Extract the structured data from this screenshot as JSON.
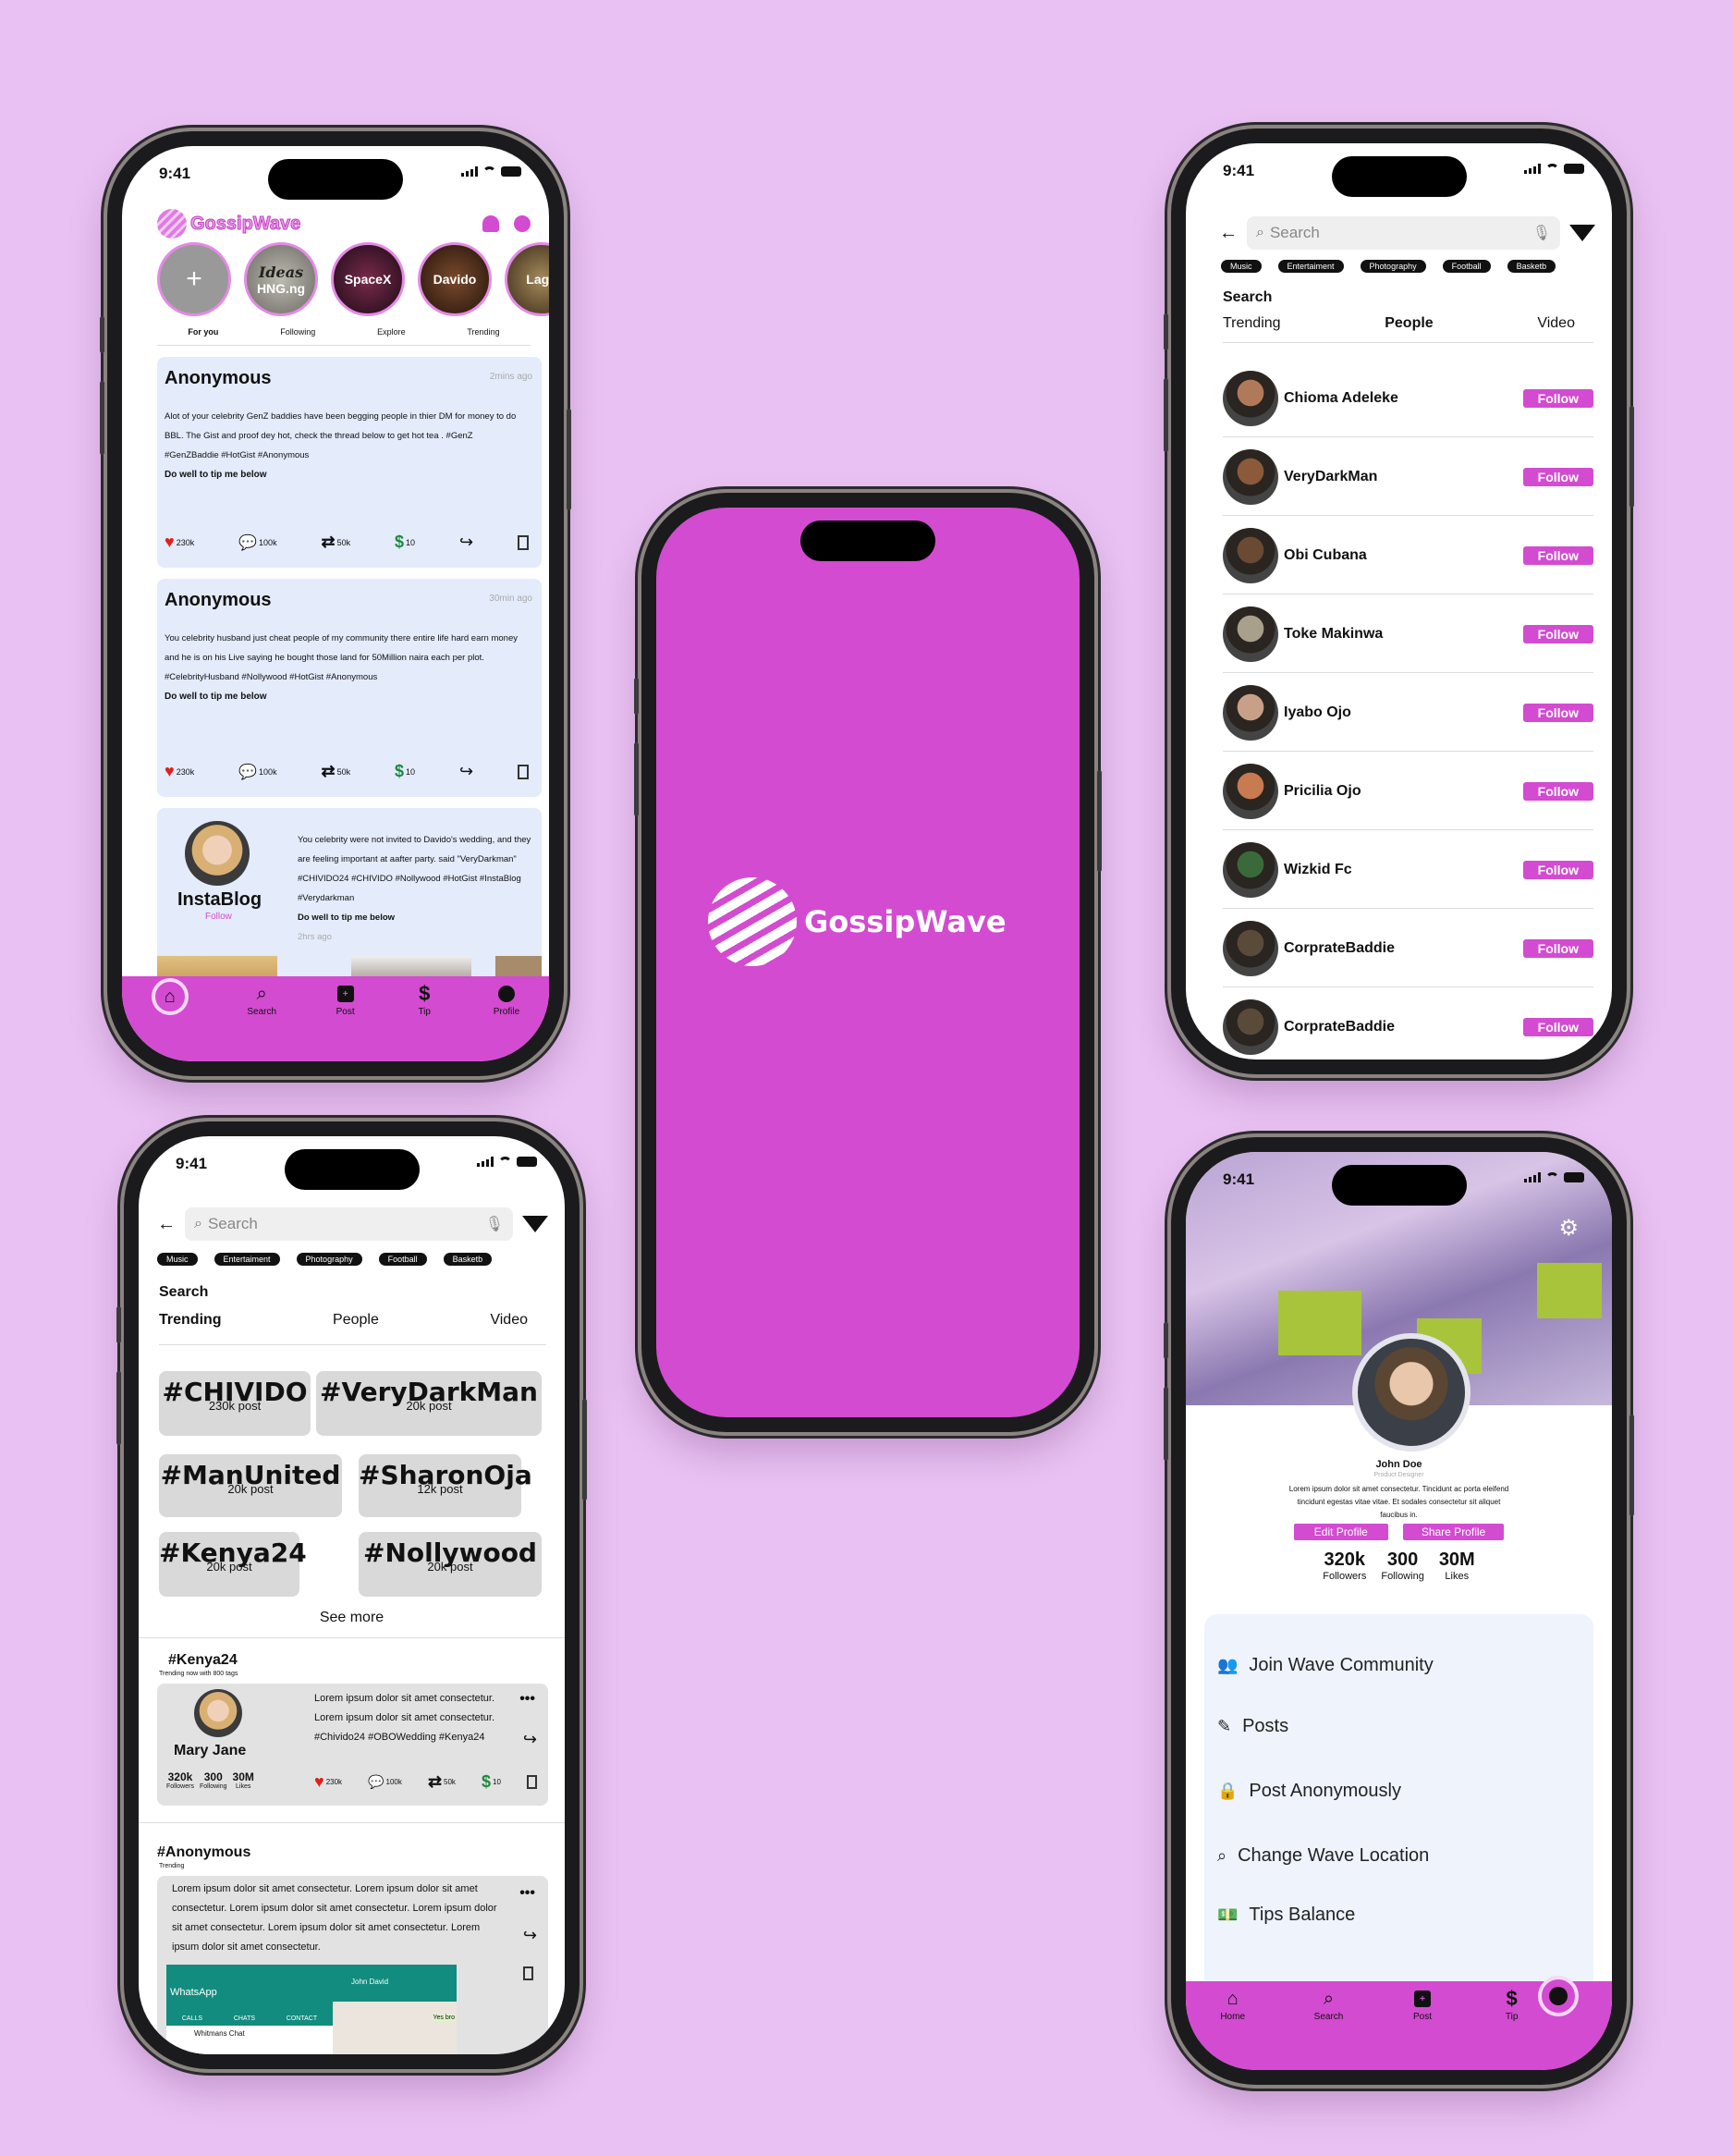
{
  "brand": {
    "name": "GossipWave",
    "primary": "#d34bd0",
    "background": "#e9c1f2"
  },
  "status": {
    "time": "9:41"
  },
  "feed": {
    "logo": "GossipWave",
    "stories": [
      {
        "label": "+"
      },
      {
        "label": "HNG.ng",
        "caption": "Ideas"
      },
      {
        "label": "SpaceX"
      },
      {
        "label": "Davido"
      },
      {
        "label": "Lago"
      }
    ],
    "tabs": [
      "For you",
      "Following",
      "Explore",
      "Trending"
    ],
    "posts": [
      {
        "author": "Anonymous",
        "ago": "2mins ago",
        "text": "Alot of your celebrity GenZ baddies have been begging people in thier DM for money to do BBL. The Gist and proof dey hot, check the thread below to get hot tea . #GenZ #GenZBaddie #HotGist #Anonymous",
        "cta": "Do well to tip me below",
        "likes": "230k",
        "comments": "100k",
        "reposts": "50k",
        "tips": "10"
      },
      {
        "author": "Anonymous",
        "ago": "30min ago",
        "text": "You celebrity husband just cheat people of my community there entire life hard earn money and he is on his Live saying he bought those land for 50Million naira each per plot. #CelebrityHusband #Nollywood #HotGist #Anonymous",
        "cta": "Do well to tip me below",
        "likes": "230k",
        "comments": "100k",
        "reposts": "50k",
        "tips": "10"
      }
    ],
    "blog": {
      "name": "InstaBlog",
      "follow": "Follow",
      "text": "You celebrity were not invited to Davido's wedding, and they are feeling important at aafter party. said \"VeryDarkman\" #CHIVIDO24 #CHIVIDO #Nollywood #HotGist #InstaBlog #Verydarkman",
      "cta": "Do well to tip me below",
      "ago": "2hrs ago"
    },
    "nav": [
      "Search",
      "Post",
      "Tip",
      "Profile"
    ]
  },
  "search_people": {
    "placeholder": "Search",
    "chips": [
      "Music",
      "Entertaiment",
      "Photography",
      "Football",
      "Basketb"
    ],
    "heading": "Search",
    "tabs": [
      "Trending",
      "People",
      "Video"
    ],
    "follow_label": "Follow",
    "people": [
      "Chioma Adeleke",
      "VeryDarkMan",
      "Obi Cubana",
      "Toke Makinwa",
      "Iyabo Ojo",
      "Pricilia Ojo",
      "Wizkid Fc",
      "CorprateBaddie",
      "CorprateBaddie"
    ]
  },
  "search_trending": {
    "placeholder": "Search",
    "chips": [
      "Music",
      "Entertaiment",
      "Photography",
      "Football",
      "Basketb"
    ],
    "heading": "Search",
    "tabs": [
      "Trending",
      "People",
      "Video"
    ],
    "tags": [
      {
        "tag": "#CHIVIDO",
        "count": "230k post"
      },
      {
        "tag": "#VeryDarkMan",
        "count": "20k post"
      },
      {
        "tag": "#ManUnited",
        "count": "20k post"
      },
      {
        "tag": "#SharonOja",
        "count": "12k post"
      },
      {
        "tag": "#Kenya24",
        "count": "20k post"
      },
      {
        "tag": "#Nollywood",
        "count": "20k post"
      }
    ],
    "see_more": "See more",
    "section1": {
      "tag": "#Kenya24",
      "sub": "Trending now with 800 tags",
      "user": "Mary Jane",
      "followers": "320k",
      "following": "300",
      "likes": "30M",
      "followers_l": "Followers",
      "following_l": "Following",
      "likes_l": "Likes",
      "text": "Lorem ipsum dolor sit amet consectetur. Lorem ipsum dolor sit amet consectetur. #Chivido24 #OBOWedding #Kenya24",
      "likes_c": "230k",
      "comments": "100k",
      "reposts": "50k",
      "tips": "10"
    },
    "section2": {
      "tag": "#Anonymous",
      "sub": "Trending",
      "text": "Lorem ipsum dolor sit amet consectetur. Lorem ipsum dolor sit amet consectetur. Lorem ipsum dolor sit amet consectetur. Lorem ipsum dolor sit amet consectetur. Lorem ipsum dolor sit amet consectetur. Lorem ipsum dolor sit amet consectetur.",
      "wa_title": "WhatsApp",
      "wa_tabs": [
        "CALLS",
        "CHATS",
        "CONTACT"
      ],
      "wa_contact": "John David",
      "wa_chat": "Whitmans Chat",
      "wa_reply": "Yes bro"
    }
  },
  "splash": {
    "name": "GossipWave"
  },
  "profile": {
    "name": "John Doe",
    "role": "Product Designer",
    "bio": "Lorem ipsum dolor sit amet consectetur. Tincidunt ac porta eleifend tincidunt egestas vitae vitae. Et sodales consectetur sit aliquet faucibus in.",
    "edit": "Edit Profile",
    "share": "Share Profile",
    "stats": [
      {
        "value": "320k",
        "label": "Followers"
      },
      {
        "value": "300",
        "label": "Following"
      },
      {
        "value": "30M",
        "label": "Likes"
      }
    ],
    "menu": [
      "Join Wave Community",
      "Posts",
      "Post Anonymously",
      "Change Wave Location",
      "Tips Balance"
    ],
    "nav": [
      "Home",
      "Search",
      "Post",
      "Tip"
    ]
  }
}
